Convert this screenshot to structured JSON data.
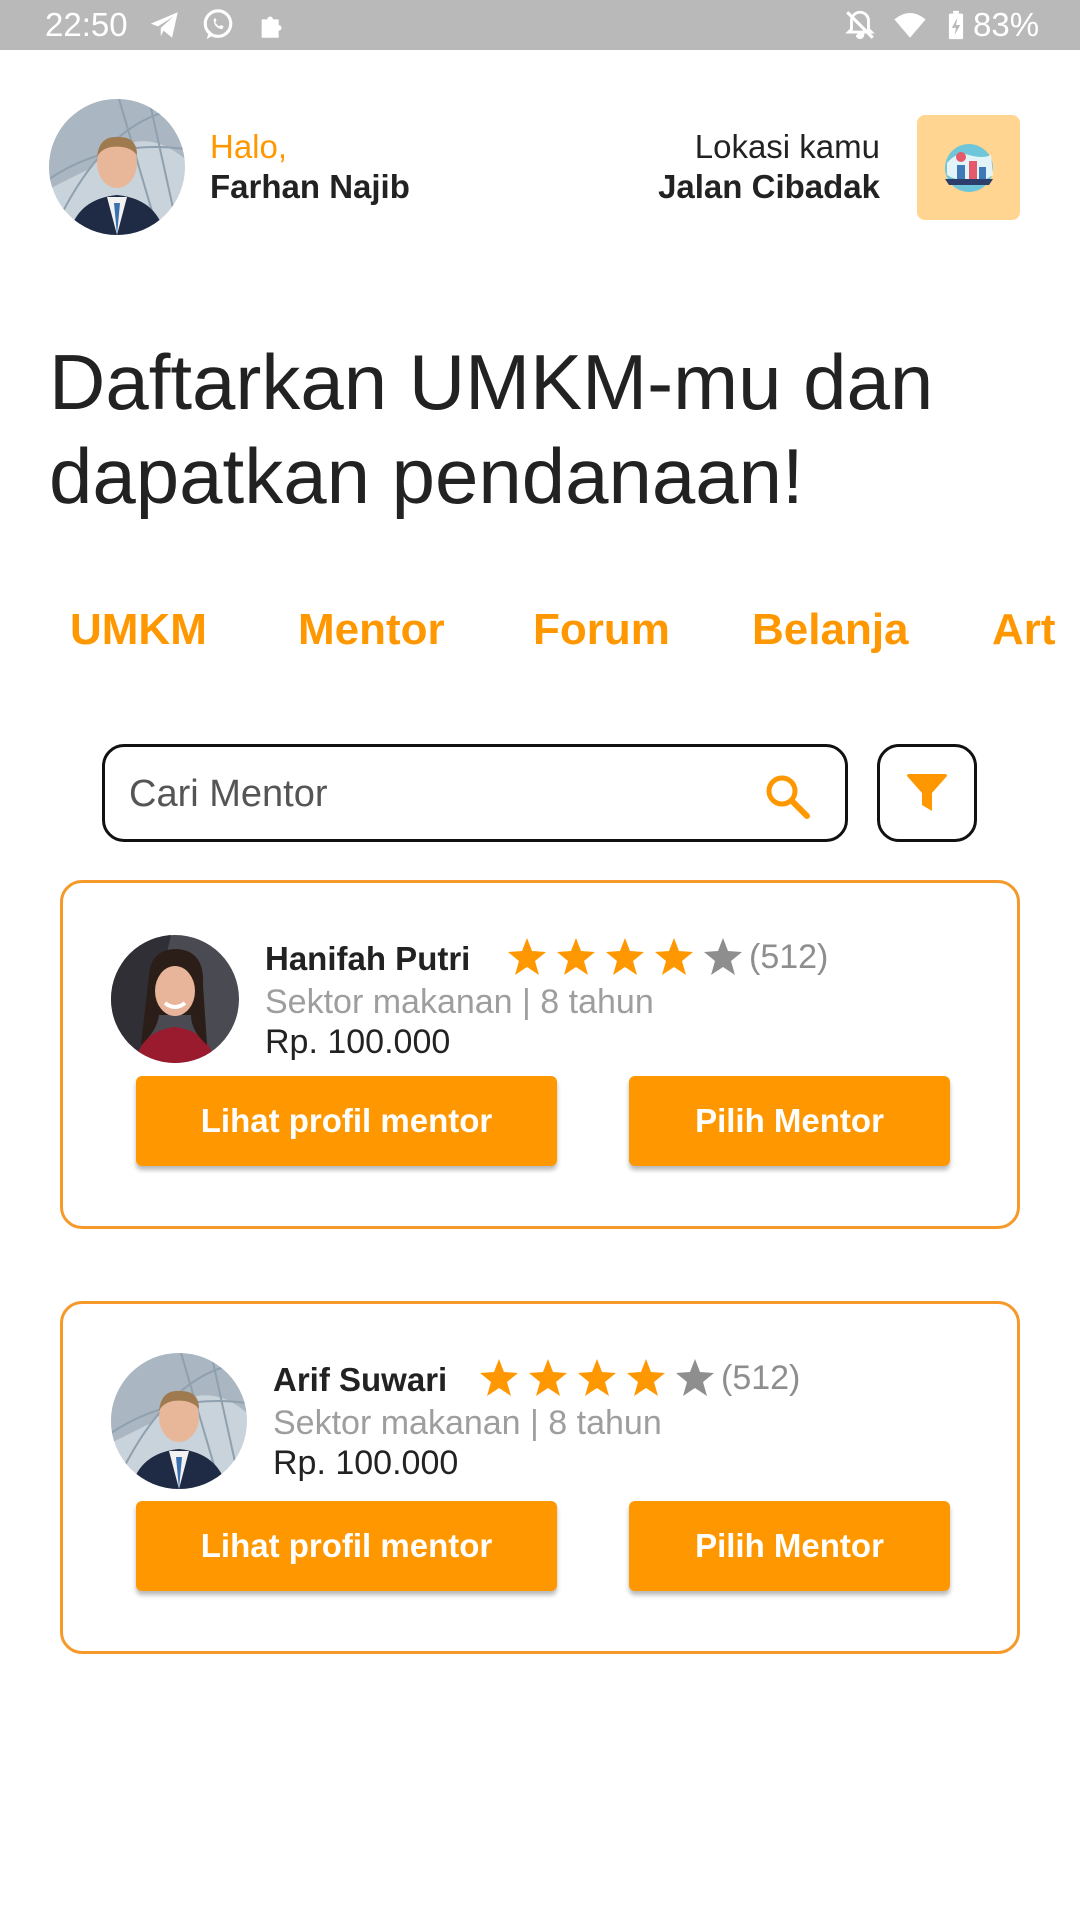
{
  "status_bar": {
    "time": "22:50",
    "battery": "83%",
    "icons": [
      "telegram-icon",
      "whatsapp-icon",
      "puzzle-icon",
      "bell-off-icon",
      "wifi-icon",
      "battery-icon"
    ]
  },
  "header": {
    "greeting": "Halo,",
    "user_name": "Farhan Najib",
    "location_label": "Lokasi kamu",
    "location_value": "Jalan Cibadak"
  },
  "headline": "Daftarkan UMKM-mu dan dapatkan pendanaan!",
  "tabs": [
    "UMKM",
    "Mentor",
    "Forum",
    "Belanja",
    "Art"
  ],
  "search": {
    "placeholder": "Cari Mentor"
  },
  "colors": {
    "accent": "#ff9800",
    "card_border": "#f59a2a",
    "star_filled": "#ff9800",
    "star_empty": "#8e8e8e"
  },
  "mentors": [
    {
      "name": "Hanifah Putri",
      "rating": 4,
      "rating_max": 5,
      "reviews": "(512)",
      "sector": "Sektor makanan | 8 tahun",
      "price": "Rp. 100.000",
      "view_button": "Lihat profil mentor",
      "select_button": "Pilih Mentor"
    },
    {
      "name": "Arif Suwari",
      "rating": 4,
      "rating_max": 5,
      "reviews": "(512)",
      "sector": "Sektor makanan | 8 tahun",
      "price": "Rp. 100.000",
      "view_button": "Lihat profil mentor",
      "select_button": "Pilih Mentor"
    }
  ]
}
